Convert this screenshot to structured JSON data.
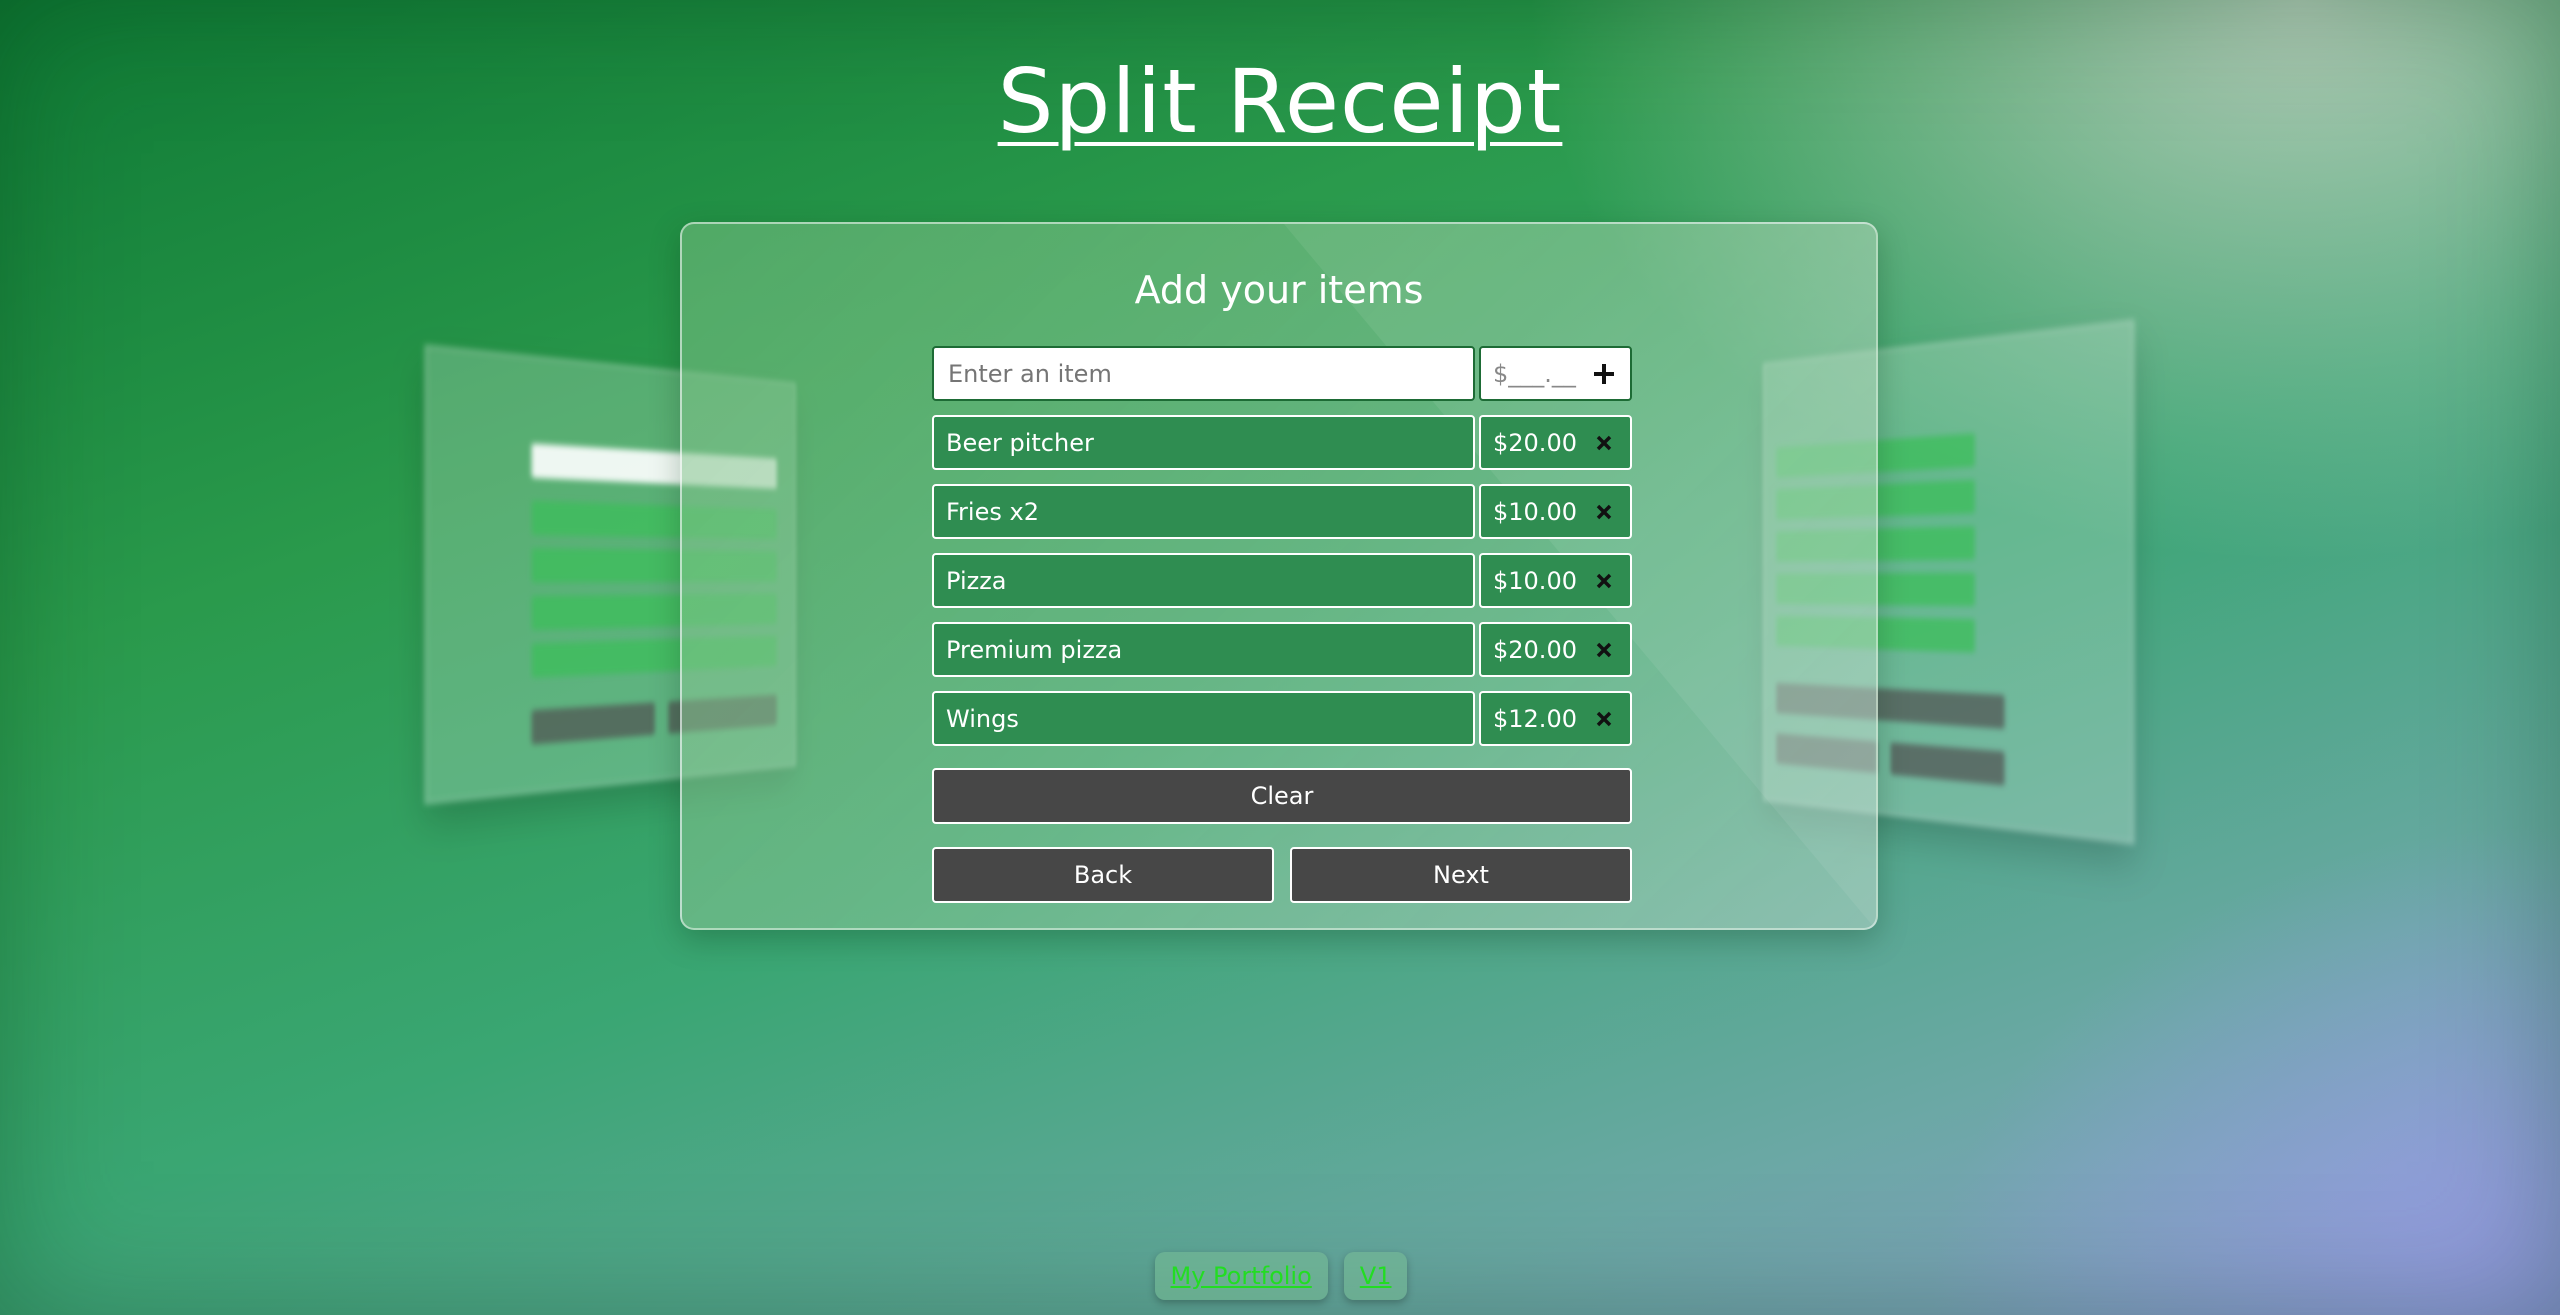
{
  "page": {
    "title": "Split Receipt"
  },
  "card": {
    "heading": "Add your items",
    "entry": {
      "item_placeholder": "Enter an item",
      "price_placeholder": "$___.__",
      "add_icon": "plus-icon"
    },
    "items": [
      {
        "name": "Beer pitcher",
        "price": "$20.00"
      },
      {
        "name": "Fries x2",
        "price": "$10.00"
      },
      {
        "name": "Pizza",
        "price": "$10.00"
      },
      {
        "name": "Premium pizza",
        "price": "$20.00"
      },
      {
        "name": "Wings",
        "price": "$12.00"
      }
    ],
    "remove_icon": "close-icon",
    "clear_label": "Clear",
    "back_label": "Back",
    "next_label": "Next"
  },
  "footer": {
    "portfolio_label": "My Portfolio",
    "version_label": "V1"
  },
  "colors": {
    "item_green": "#2f8d51",
    "button_gray": "#474747",
    "link_green": "#22dd22"
  }
}
